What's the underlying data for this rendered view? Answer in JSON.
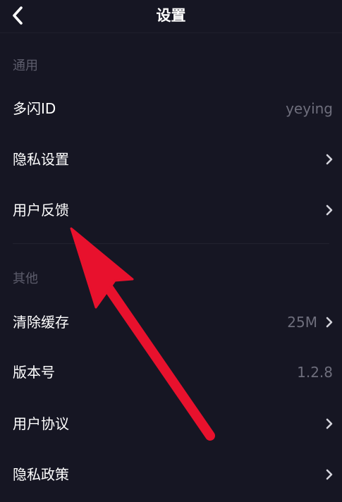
{
  "header": {
    "back_icon": "chevron-left-icon",
    "title": "设置"
  },
  "sections": {
    "general": {
      "title": "通用",
      "items": [
        {
          "label": "多闪ID",
          "value": "yeying"
        },
        {
          "label": "隐私设置",
          "icon": "chevron-right-icon"
        },
        {
          "label": "用户反馈",
          "icon": "chevron-right-icon"
        }
      ]
    },
    "other": {
      "title": "其他",
      "items": [
        {
          "label": "清除缓存",
          "value": "25M",
          "icon": "chevron-right-icon"
        },
        {
          "label": "版本号",
          "value": "1.2.8"
        },
        {
          "label": "用户协议",
          "icon": "chevron-right-icon"
        },
        {
          "label": "隐私政策",
          "icon": "chevron-right-icon"
        }
      ]
    }
  },
  "colors": {
    "background": "#161623",
    "primary_text": "#ffffff",
    "secondary_text": "#6e6e7c",
    "section_header": "#5d5d6c",
    "annotation_arrow": "#e8112d"
  }
}
